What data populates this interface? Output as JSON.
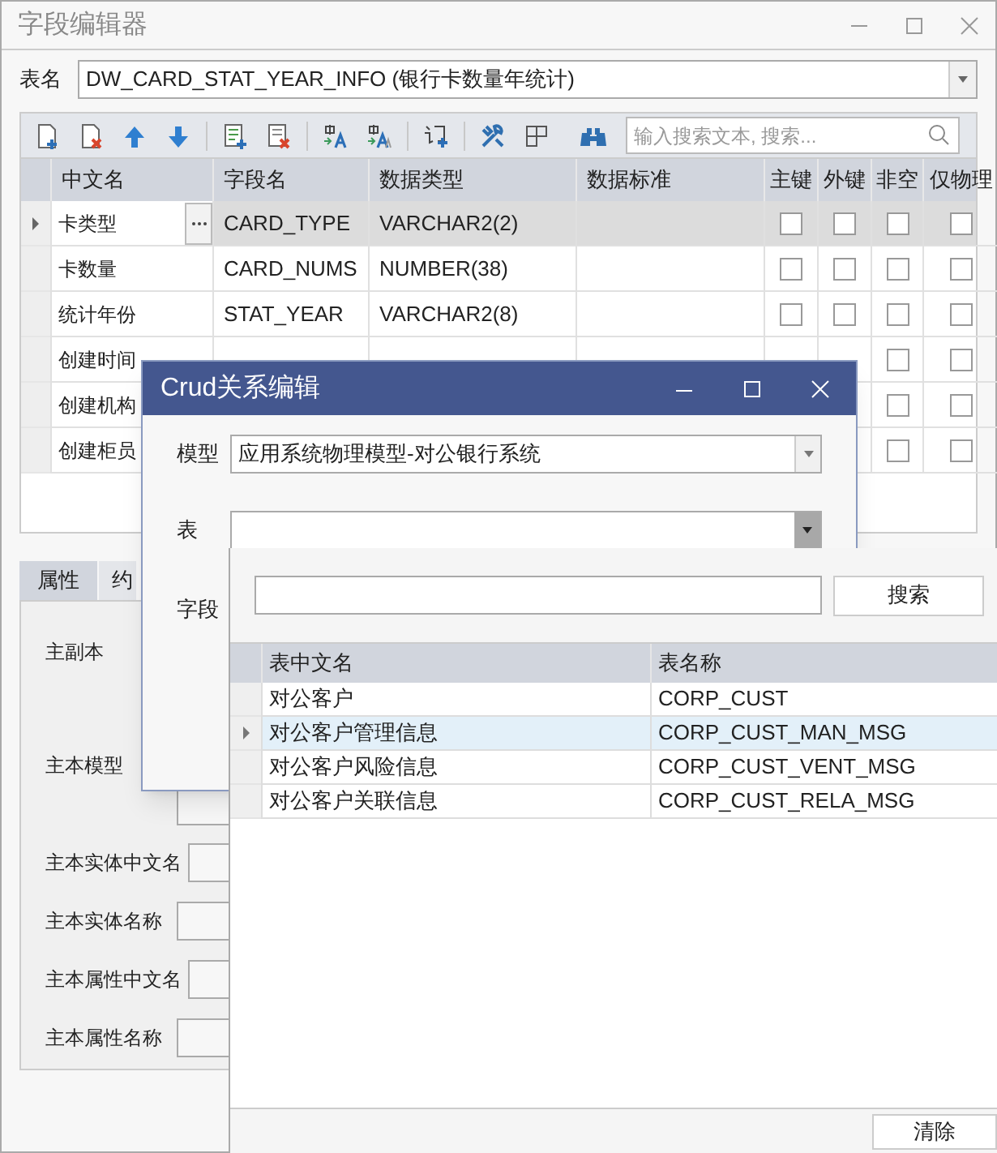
{
  "window": {
    "title": "字段编辑器"
  },
  "table_name": {
    "label": "表名",
    "value": "DW_CARD_STAT_YEAR_INFO (银行卡数量年统计)"
  },
  "toolbar": {
    "search_placeholder": "输入搜索文本, 搜索..."
  },
  "fields": {
    "columns": [
      "中文名",
      "字段名",
      "数据类型",
      "数据标准",
      "主键",
      "外键",
      "非空",
      "仅物理"
    ],
    "rows": [
      {
        "cn": "卡类型",
        "name": "CARD_TYPE",
        "type": "VARCHAR2(2)",
        "selected": true,
        "checks": {
          "pk": false,
          "fk": false,
          "not_null": false,
          "physical_only": false
        }
      },
      {
        "cn": "卡数量",
        "name": "CARD_NUMS",
        "type": "NUMBER(38)",
        "selected": false,
        "checks": {
          "pk": false,
          "fk": false,
          "not_null": false,
          "physical_only": false
        }
      },
      {
        "cn": "统计年份",
        "name": "STAT_YEAR",
        "type": "VARCHAR2(8)",
        "selected": false,
        "checks": {
          "pk": false,
          "fk": false,
          "not_null": false,
          "physical_only": false
        }
      },
      {
        "cn": "创建时间",
        "selected": false,
        "checks": {
          "not_null": false,
          "physical_only": false
        }
      },
      {
        "cn": "创建机构",
        "selected": false,
        "checks": {
          "not_null": false,
          "physical_only": false
        }
      },
      {
        "cn": "创建柜员",
        "selected": false,
        "checks": {
          "not_null": false,
          "physical_only": false
        }
      }
    ]
  },
  "tabs": [
    {
      "label": "属性",
      "selected": true
    },
    {
      "label": "约",
      "selected": false
    }
  ],
  "properties": [
    {
      "label": "主副本"
    },
    {
      "label": "主本模型",
      "field": true
    },
    {
      "label": "主本实体中文名",
      "field": true
    },
    {
      "label": "主本实体名称",
      "field": true
    },
    {
      "label": "主本属性中文名",
      "field": true
    },
    {
      "label": "主本属性名称",
      "field": true
    }
  ],
  "dialog": {
    "title": "Crud关系编辑",
    "model": {
      "label": "模型",
      "value": "应用系统物理模型-对公银行系统"
    },
    "table": {
      "label": "表",
      "expanded": true
    },
    "field": {
      "label": "字段"
    }
  },
  "popup": {
    "search_button": "搜索",
    "columns": [
      "表中文名",
      "表名称"
    ],
    "rows": [
      {
        "cn": "对公客户",
        "name": "CORP_CUST",
        "selected": false
      },
      {
        "cn": "对公客户管理信息",
        "name": "CORP_CUST_MAN_MSG",
        "selected": true
      },
      {
        "cn": "对公客户风险信息",
        "name": "CORP_CUST_VENT_MSG",
        "selected": false
      },
      {
        "cn": "对公客户关联信息",
        "name": "CORP_CUST_RELA_MSG",
        "selected": false
      }
    ],
    "clear_button": "清除"
  }
}
